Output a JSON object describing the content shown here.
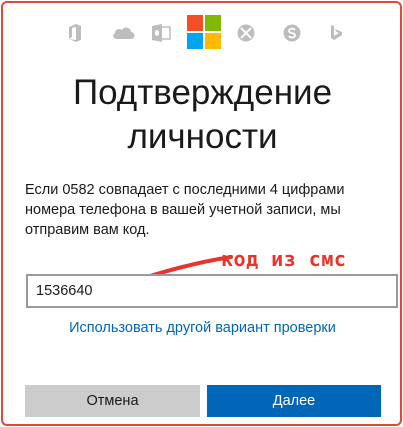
{
  "header": {
    "icons": [
      "office-icon",
      "onedrive-icon",
      "outlook-icon",
      "microsoft-logo",
      "xbox-icon",
      "skype-icon",
      "bing-icon"
    ]
  },
  "title_line1": "Подтверждение",
  "title_line2": "личности",
  "description_line1": "Если 0582 совпадает с последними 4 цифрами",
  "description_line2": "номера телефона в вашей учетной записи, мы",
  "description_line3": "отправим вам код.",
  "annotation": "код из смс",
  "code_field": {
    "value": "1536640"
  },
  "alt_link": "Использовать другой вариант проверки",
  "buttons": {
    "cancel": "Отмена",
    "next": "Далее"
  },
  "colors": {
    "frame": "#e04a3a",
    "annotation": "#e8342a",
    "primary": "#0067b8",
    "link": "#0067b8",
    "cancel_bg": "#cccccc",
    "ms_red": "#f25022",
    "ms_green": "#7fba00",
    "ms_blue": "#00a4ef",
    "ms_yellow": "#ffb900"
  }
}
